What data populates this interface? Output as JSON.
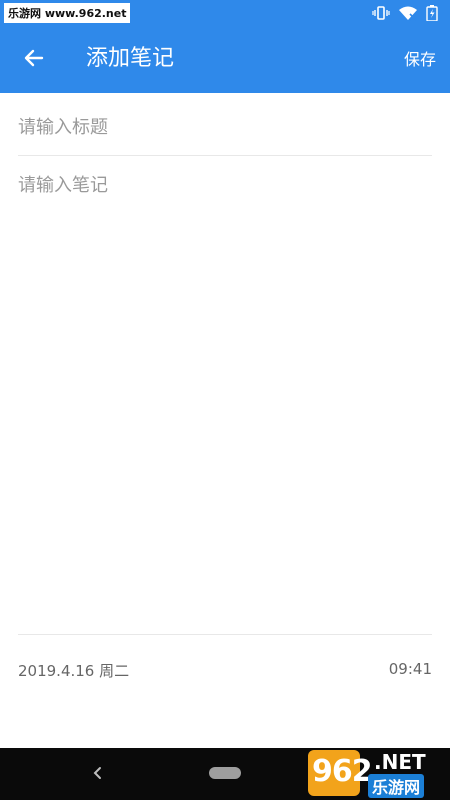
{
  "status_bar": {
    "watermark_text": "乐游网 www.962.net",
    "icons": [
      "vibrate-icon",
      "wifi-icon",
      "battery-icon"
    ]
  },
  "app_bar": {
    "back_icon": "arrow-left-icon",
    "title": "添加笔记",
    "save_label": "保存"
  },
  "form": {
    "title_placeholder": "请输入标题",
    "title_value": "",
    "note_placeholder": "请输入笔记",
    "note_value": ""
  },
  "footer": {
    "date": "2019.4.16 周二",
    "time": "09:41"
  },
  "nav_bar": {
    "back_icon": "nav-back-icon",
    "home_icon": "nav-home-pill"
  },
  "logo_watermark": {
    "number": "962",
    "net": ".NET",
    "cn": "乐游网"
  },
  "colors": {
    "primary": "#2f89ea",
    "nav_bar": "#0a0a0a",
    "placeholder": "#9a9a9a",
    "divider": "#e8e8e8"
  }
}
